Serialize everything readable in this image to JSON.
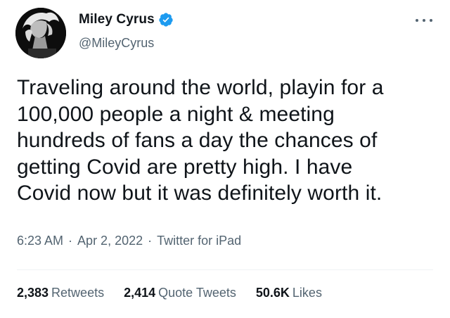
{
  "author": {
    "display_name": "Miley Cyrus",
    "handle": "@MileyCyrus",
    "verified": true,
    "verified_color": "#1d9bf0"
  },
  "tweet": {
    "lines": [
      "Traveling around the world, playin for a",
      "100,000 people a night & meeting",
      "hundreds of fans a day the chances of",
      "getting Covid are pretty high. I have",
      "Covid now but it was definitely worth it."
    ],
    "time": "6:23 AM",
    "date": "Apr 2, 2022",
    "source": "Twitter for iPad",
    "separator": "·"
  },
  "stats": {
    "retweets_count": "2,383",
    "retweets_label": "Retweets",
    "quotes_count": "2,414",
    "quotes_label": "Quote Tweets",
    "likes_count": "50.6K",
    "likes_label": "Likes"
  },
  "icons": {
    "verified": "verified-badge-icon",
    "more": "more-options-icon"
  }
}
